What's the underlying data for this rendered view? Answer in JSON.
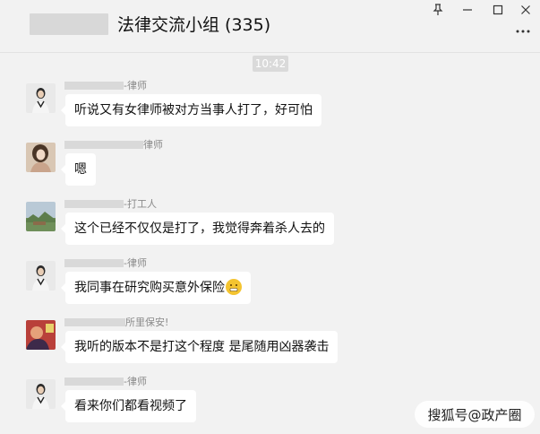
{
  "header": {
    "title": "法律交流小组 (335)",
    "controls": {
      "pin_icon": "pin-icon",
      "min_icon": "minimize-icon",
      "max_icon": "maximize-icon",
      "close_icon": "close-icon",
      "more_icon": "more-icon"
    }
  },
  "time_divider": "10:42",
  "messages": [
    {
      "sender_suffix": "-律师",
      "text": "听说又有女律师被对方当事人打了，好可怕",
      "avatar": "avatar-woman-lawyer"
    },
    {
      "sender_suffix": "律师",
      "text": "嗯",
      "avatar": "avatar-woman-portrait"
    },
    {
      "sender_suffix": "-打工人",
      "text": "这个已经不仅仅是打了，我觉得奔着杀人去的",
      "avatar": "avatar-landscape"
    },
    {
      "sender_suffix": "-律师",
      "text": "我同事在研究购买意外保险",
      "emoji": "grimace-emoji",
      "avatar": "avatar-woman-lawyer"
    },
    {
      "sender_suffix": "所里保安!",
      "text": "我听的版本不是打这个程度 是尾随用凶器袭击",
      "avatar": "avatar-colorful"
    },
    {
      "sender_suffix": "-律师",
      "text": "看来你们都看视频了",
      "avatar": "avatar-woman-lawyer"
    }
  ],
  "watermark": "搜狐号@政产圈",
  "colors": {
    "background": "#f2f2f2",
    "bubble": "#ffffff",
    "sender_text": "#8a8a8a",
    "time_badge": "#dadada"
  }
}
